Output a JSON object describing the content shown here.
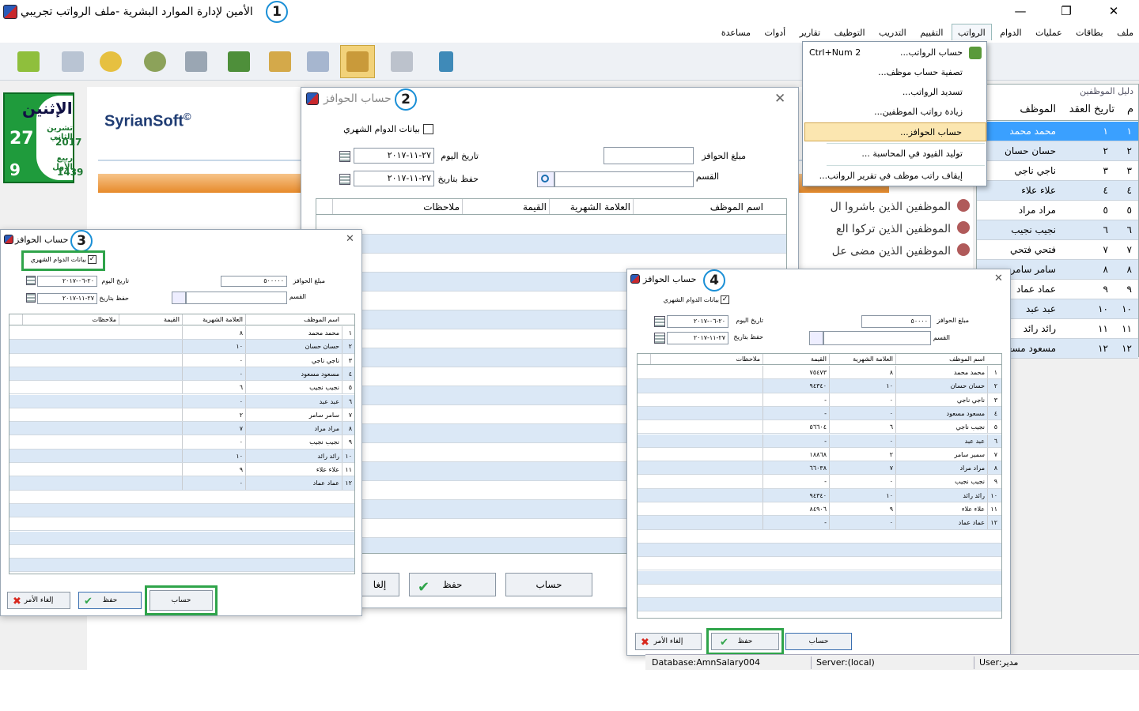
{
  "app": {
    "title": "الأمين لإدارة الموارد البشرية -ملف الرواتب تجريبي",
    "badges": [
      "1",
      "2",
      "3",
      "4"
    ]
  },
  "window_controls": {
    "minimize": "—",
    "maximize": "❐",
    "close": "✕"
  },
  "menu": [
    "ملف",
    "بطاقات",
    "عمليات",
    "الدوام",
    "الرواتب",
    "التقييم",
    "التدريب",
    "التوظيف",
    "تقارير",
    "أدوات",
    "مساعدة"
  ],
  "salaries_menu": {
    "items": [
      {
        "label": "حساب الرواتب...",
        "shortcut": "Ctrl+Num 2"
      },
      {
        "label": "تصفية حساب موظف..."
      },
      {
        "label": "تسديد الرواتب..."
      },
      {
        "label": "زيادة رواتب الموظفين..."
      },
      {
        "label": "حساب الحوافز..."
      },
      {
        "label": "توليد القيود في المحاسبة ..."
      },
      {
        "label": "إيقاف راتب موظف في تقرير الرواتب..."
      }
    ]
  },
  "date_panel": {
    "day": "الإثنين",
    "greg_day": "27",
    "greg_month": "تشرين الثاني",
    "greg_year": "2017",
    "hijri_day": "9",
    "hijri_month": "ربيع الأول",
    "hijri_year": "1439"
  },
  "brand": {
    "name": "SyrianSoft",
    "mark": "©"
  },
  "employee_guide": {
    "title": "دليل الموظفين",
    "headers": {
      "num": "م",
      "contract_date": "تاريخ العقد",
      "employee": "الموظف"
    },
    "rows": [
      {
        "num": "١",
        "code": "١",
        "name": "محمد محمد"
      },
      {
        "num": "٢",
        "code": "٢",
        "name": "حسان حسان"
      },
      {
        "num": "٣",
        "code": "٣",
        "name": "ناجي ناجي"
      },
      {
        "num": "٤",
        "code": "٤",
        "name": "علاء علاء"
      },
      {
        "num": "٥",
        "code": "٥",
        "name": "مراد مراد"
      },
      {
        "num": "٦",
        "code": "٦",
        "name": "نجيب نجيب"
      },
      {
        "num": "٧",
        "code": "٧",
        "name": "فتحي فتحي"
      },
      {
        "num": "٨",
        "code": "٨",
        "name": "سامر سامر"
      },
      {
        "num": "٩",
        "code": "٩",
        "name": "عماد عماد"
      },
      {
        "num": "١٠",
        "code": "١٠",
        "name": "عبد عبد"
      },
      {
        "num": "١١",
        "code": "١١",
        "name": "رائد رائد"
      },
      {
        "num": "١٢",
        "code": "١٢",
        "name": "مسعود مسعود"
      }
    ]
  },
  "notices": [
    "الموظفين الذين باشروا ال",
    "الموظفين الذين تركوا الع",
    "الموظفين الذين مضى عل"
  ],
  "dialog_common": {
    "title": "حساب الحوافز",
    "monthly_attendance": "بيانات الدوام الشهري",
    "amount_label": "مبلغ الحوافز",
    "today_label": "تاريخ اليوم",
    "department_label": "القسم",
    "save_date_label": "حفظ بتاريخ",
    "columns": {
      "employee": "اسم الموظف",
      "monthly_score": "العلامة الشهرية",
      "value": "القيمة",
      "notes": "ملاحظات"
    },
    "btn_calc": "حساب",
    "btn_save": "حفظ",
    "btn_cancel": "إلغاء الأمر"
  },
  "dialog2": {
    "amount": "",
    "today": "٢٧-١١-٢٠١٧",
    "save_date": "٢٧-١١-٢٠١٧",
    "cancel_partial": "إلغا"
  },
  "dialog3": {
    "amount": "٥٠٠٠٠٠",
    "today": "٢٠-٠٦-٢٠١٧",
    "save_date": "٢٧-١١-٢٠١٧",
    "rows": [
      {
        "n": "١",
        "name": "محمد محمد",
        "score": "٨"
      },
      {
        "n": "٢",
        "name": "حسان حسان",
        "score": "١٠"
      },
      {
        "n": "٣",
        "name": "ناجي ناجي",
        "score": "٠"
      },
      {
        "n": "٤",
        "name": "مسعود مسعود",
        "score": "٠"
      },
      {
        "n": "٥",
        "name": "نجيب نجيب",
        "score": "٦"
      },
      {
        "n": "٦",
        "name": "عبد عبد",
        "score": "٠"
      },
      {
        "n": "٧",
        "name": "سامر سامر",
        "score": "٢"
      },
      {
        "n": "٨",
        "name": "مراد مراد",
        "score": "٧"
      },
      {
        "n": "٩",
        "name": "نجيب نجيب",
        "score": "٠"
      },
      {
        "n": "١٠",
        "name": "رائد رائد",
        "score": "١٠"
      },
      {
        "n": "١١",
        "name": "علاء علاء",
        "score": "٩"
      },
      {
        "n": "١٢",
        "name": "عماد عماد",
        "score": "٠"
      }
    ]
  },
  "dialog4": {
    "amount": "٥٠٠٠٠",
    "today": "٢٠-٠٦-٢٠١٧",
    "save_date": "٢٧-١١-٢٠١٧",
    "rows": [
      {
        "n": "١",
        "name": "محمد محمد",
        "score": "٨",
        "value": "٧٥٤٧٣"
      },
      {
        "n": "٢",
        "name": "حسان حسان",
        "score": "١٠",
        "value": "٩٤٣٤٠"
      },
      {
        "n": "٣",
        "name": "ناجي ناجي",
        "score": "٠",
        "value": "-"
      },
      {
        "n": "٤",
        "name": "مسعود مسعود",
        "score": "٠",
        "value": "-"
      },
      {
        "n": "٥",
        "name": "نجيب ناجي",
        "score": "٦",
        "value": "٥٦٦٠٤"
      },
      {
        "n": "٦",
        "name": "عبد عبد",
        "score": "٠",
        "value": "-"
      },
      {
        "n": "٧",
        "name": "سمير سامر",
        "score": "٢",
        "value": "١٨٨٦٨"
      },
      {
        "n": "٨",
        "name": "مراد مراد",
        "score": "٧",
        "value": "٦٦٠٣٨"
      },
      {
        "n": "٩",
        "name": "نجيب نجيب",
        "score": "٠",
        "value": "-"
      },
      {
        "n": "١٠",
        "name": "رائد رائد",
        "score": "١٠",
        "value": "٩٤٣٤٠"
      },
      {
        "n": "١١",
        "name": "علاء علاء",
        "score": "٩",
        "value": "٨٤٩٠٦"
      },
      {
        "n": "١٢",
        "name": "عماد عماد",
        "score": "٠",
        "value": "-"
      }
    ]
  },
  "statusbar": {
    "database": "Database:AmnSalary004",
    "server": "Server:(local)",
    "user": "User:مدير"
  },
  "colors": {
    "highlight_row": "#3aa0ff",
    "green_outline": "#2fa44a",
    "date_panel": "#1f9b3c",
    "badge_ring": "#1a8fd6"
  }
}
